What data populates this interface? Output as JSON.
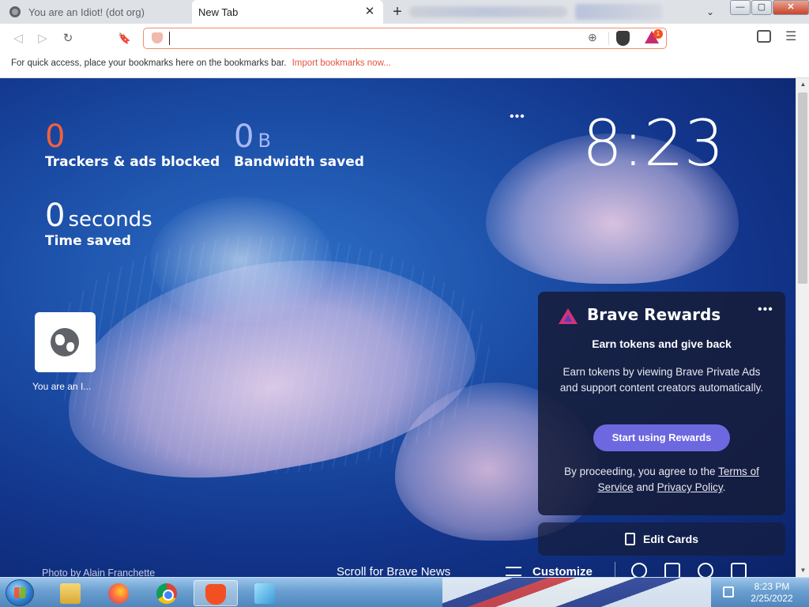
{
  "tabs": [
    {
      "title": "You are an Idiot! (dot org)",
      "active": false
    },
    {
      "title": "New Tab",
      "active": true
    }
  ],
  "tab_controls": {
    "close": "✕",
    "new_tab": "+",
    "search": "⌄"
  },
  "window_controls": {
    "minimize": "—",
    "maximize": "▢",
    "close": "✕"
  },
  "toolbar": {
    "back": "◁",
    "forward": "▷",
    "reload": "↻",
    "bookmark": "🔖",
    "address_value": "",
    "rewards_badge": "1",
    "menu": "☰",
    "zoom": "⊕"
  },
  "bookmarks_bar": {
    "hint": "For quick access, place your bookmarks here on the bookmarks bar.",
    "import_link": "Import bookmarks now..."
  },
  "stats": {
    "trackers": {
      "value": "0",
      "label": "Trackers & ads blocked"
    },
    "bandwidth": {
      "value": "0",
      "unit": "B",
      "label": "Bandwidth saved"
    },
    "time": {
      "value": "0",
      "unit": "seconds",
      "label": "Time saved"
    }
  },
  "clock": {
    "time": "8:23",
    "more": "•••"
  },
  "top_sites": [
    {
      "label": "You are an I..."
    }
  ],
  "rewards_card": {
    "title": "Brave Rewards",
    "more": "•••",
    "heading": "Earn tokens and give back",
    "description": "Earn tokens by viewing Brave Private Ads and support content creators automatically.",
    "button": "Start using Rewards",
    "terms_prefix": "By proceeding, you agree to the",
    "terms_link": "Terms of Service",
    "terms_and": "and",
    "privacy_link": "Privacy Policy",
    "terms_suffix": "."
  },
  "edit_cards": "Edit Cards",
  "footer": {
    "photo_credit": "Photo by Alain Franchette",
    "scroll_news": "Scroll for Brave News",
    "customize": "Customize"
  },
  "taskbar": {
    "apps": [
      "windows-explorer",
      "firefox",
      "chrome",
      "brave",
      "notepad"
    ],
    "time": "8:23 PM",
    "date": "2/25/2022"
  },
  "colors": {
    "accent_orange": "#f06040",
    "bandwidth_blue": "#a9b8f5",
    "rewards_button": "#6d68e0",
    "omnibox_border": "#f28d6b"
  }
}
